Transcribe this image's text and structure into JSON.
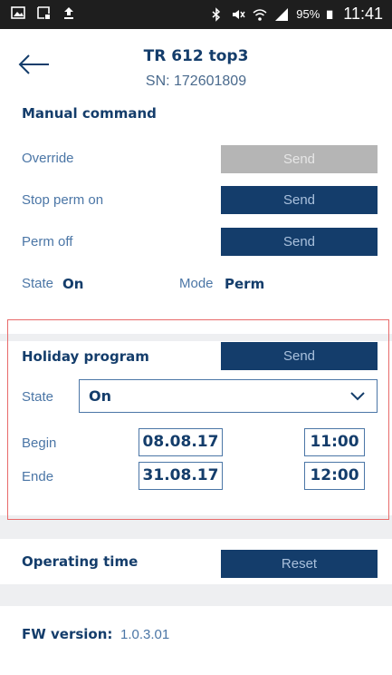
{
  "status_bar": {
    "battery_percent": "95%",
    "time": "11:41"
  },
  "header": {
    "title": "TR 612 top3",
    "serial": "SN: 172601809"
  },
  "manual_command": {
    "title": "Manual command",
    "rows": [
      {
        "label": "Override",
        "button": "Send",
        "enabled": false
      },
      {
        "label": "Stop perm on",
        "button": "Send",
        "enabled": true
      },
      {
        "label": "Perm off",
        "button": "Send",
        "enabled": true
      }
    ],
    "state_label": "State",
    "state_value": "On",
    "mode_label": "Mode",
    "mode_value": "Perm"
  },
  "holiday_program": {
    "title": "Holiday program",
    "send_button": "Send",
    "state_label": "State",
    "state_selected": "On",
    "begin_label": "Begin",
    "begin_date": "08.08.17",
    "begin_time": "11:00",
    "end_label": "Ende",
    "end_date": "31.08.17",
    "end_time": "12:00"
  },
  "operating_time": {
    "title": "Operating time",
    "reset_button": "Reset"
  },
  "firmware": {
    "label": "FW version:",
    "value": "1.0.3.01"
  },
  "colors": {
    "primary": "#143d6b",
    "label_blue": "#4b76a6",
    "disabled": "#b5b5b5",
    "highlight_frame": "#e86a6a",
    "section_gap": "#eeeff1"
  }
}
